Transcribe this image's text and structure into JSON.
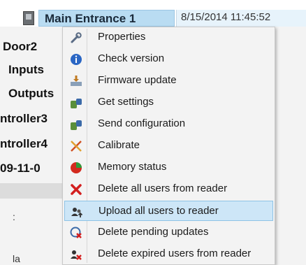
{
  "tree": {
    "selected_node": "Main Entrance 1",
    "timestamp": "8/15/2014 11:45:52",
    "items": [
      "Door2",
      "Inputs",
      "Outputs",
      "ntroller3",
      "ntroller4",
      "09-11-0"
    ],
    "fragments": [
      ":",
      "la"
    ]
  },
  "context_menu": {
    "items": [
      {
        "label": "Properties",
        "icon": "wrench-icon"
      },
      {
        "label": "Check version",
        "icon": "info-icon"
      },
      {
        "label": "Firmware update",
        "icon": "firmware-icon"
      },
      {
        "label": "Get settings",
        "icon": "get-settings-icon"
      },
      {
        "label": "Send configuration",
        "icon": "send-config-icon"
      },
      {
        "label": "Calibrate",
        "icon": "calibrate-icon"
      },
      {
        "label": "Memory status",
        "icon": "pie-chart-icon"
      },
      {
        "label": "Delete all users from reader",
        "icon": "red-x-icon"
      },
      {
        "label": "Upload all users to reader",
        "icon": "upload-users-icon",
        "highlighted": true
      },
      {
        "label": "Delete pending updates",
        "icon": "delete-pending-icon"
      },
      {
        "label": "Delete expired users from reader",
        "icon": "delete-expired-icon"
      }
    ]
  },
  "colors": {
    "selection": "#b9dcf2",
    "menu_highlight": "#cde6f7",
    "menu_background": "#f3f3f3"
  }
}
